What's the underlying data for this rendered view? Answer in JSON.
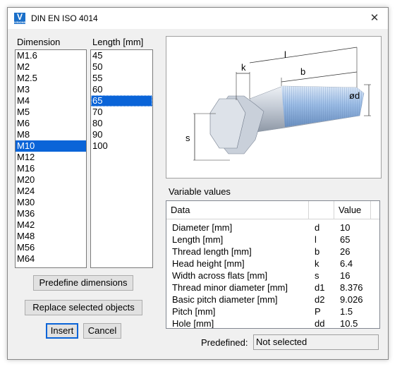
{
  "window": {
    "title": "DIN EN ISO 4014",
    "icon_letter": "V",
    "icon_sub": "VISIONS",
    "close_label": "✕"
  },
  "dimension": {
    "label": "Dimension",
    "items": [
      "M1.6",
      "M2",
      "M2.5",
      "M3",
      "M4",
      "M5",
      "M6",
      "M8",
      "M10",
      "M12",
      "M16",
      "M20",
      "M24",
      "M30",
      "M36",
      "M42",
      "M48",
      "M56",
      "M64"
    ],
    "selected": "M10"
  },
  "length": {
    "label": "Length [mm]",
    "items": [
      "45",
      "50",
      "55",
      "60",
      "65",
      "70",
      "80",
      "90",
      "100"
    ],
    "selected": "65"
  },
  "diagram": {
    "label_k": "k",
    "label_l": "l",
    "label_b": "b",
    "label_d": "ød",
    "label_s": "s"
  },
  "variables": {
    "label": "Variable values",
    "columns": [
      "Data",
      "",
      "Value"
    ],
    "rows": [
      {
        "name": "Diameter [mm]",
        "symbol": "d",
        "value": "10"
      },
      {
        "name": "Length [mm]",
        "symbol": "l",
        "value": "65"
      },
      {
        "name": "Thread length [mm]",
        "symbol": "b",
        "value": "26"
      },
      {
        "name": "Head height [mm]",
        "symbol": "k",
        "value": "6.4"
      },
      {
        "name": "Width across flats [mm]",
        "symbol": "s",
        "value": "16"
      },
      {
        "name": "Thread minor diameter [mm]",
        "symbol": "d1",
        "value": "8.376"
      },
      {
        "name": "Basic pitch diameter [mm]",
        "symbol": "d2",
        "value": "9.026"
      },
      {
        "name": "Pitch [mm]",
        "symbol": "P",
        "value": "1.5"
      },
      {
        "name": "Hole [mm]",
        "symbol": "dd",
        "value": "10.5"
      }
    ]
  },
  "buttons": {
    "predefine": "Predefine dimensions",
    "replace": "Replace selected objects",
    "insert": "Insert",
    "cancel": "Cancel"
  },
  "predefined": {
    "label": "Predefined:",
    "value": "Not selected"
  },
  "colors": {
    "selection": "#0a64d8",
    "bolt": "#b8c2cf",
    "thread": "#8fb4e3"
  }
}
